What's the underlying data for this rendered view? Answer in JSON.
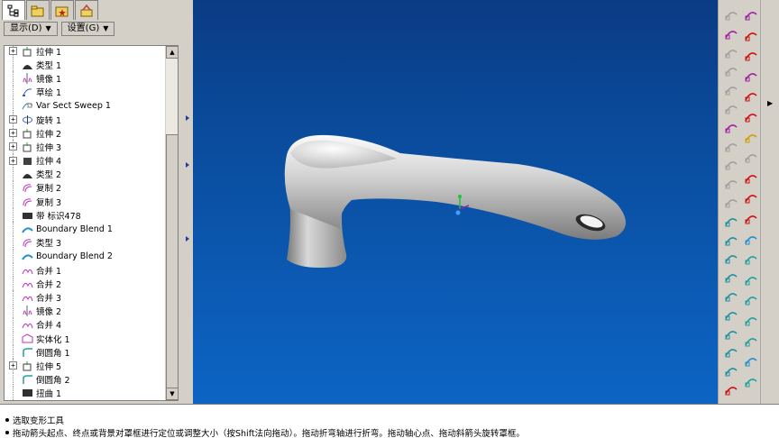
{
  "menus": {
    "show_label": "显示(D)",
    "settings_label": "设置(G)"
  },
  "tree_items": [
    {
      "label": "拉伸 1",
      "icon": "extrude-icon",
      "expandable": true
    },
    {
      "label": "类型 1",
      "icon": "style-icon",
      "expandable": false
    },
    {
      "label": "镜像 1",
      "icon": "mirror-icon",
      "expandable": false
    },
    {
      "label": "草绘 1",
      "icon": "sketch-icon",
      "expandable": false
    },
    {
      "label": "Var Sect Sweep 1",
      "icon": "sweep-icon",
      "expandable": false
    },
    {
      "label": "旋转 1",
      "icon": "revolve-icon",
      "expandable": true
    },
    {
      "label": "拉伸 2",
      "icon": "extrude-icon",
      "expandable": true
    },
    {
      "label": "拉伸 3",
      "icon": "extrude-icon",
      "expandable": true
    },
    {
      "label": "拉伸 4",
      "icon": "extrude-solid-icon",
      "expandable": true
    },
    {
      "label": "类型 2",
      "icon": "style-icon",
      "expandable": false
    },
    {
      "label": "复制 2",
      "icon": "copy-icon",
      "expandable": false
    },
    {
      "label": "复制 3",
      "icon": "copy-icon",
      "expandable": false
    },
    {
      "label": "带 标识478",
      "icon": "band-icon",
      "expandable": false
    },
    {
      "label": "Boundary Blend 1",
      "icon": "boundary-blend-icon",
      "expandable": false
    },
    {
      "label": "类型 3",
      "icon": "copy-icon",
      "expandable": false
    },
    {
      "label": "Boundary Blend 2",
      "icon": "boundary-blend-icon",
      "expandable": false
    },
    {
      "label": "合并 1",
      "icon": "merge-icon",
      "expandable": false
    },
    {
      "label": "合并 2",
      "icon": "merge-icon",
      "expandable": false
    },
    {
      "label": "合并 3",
      "icon": "merge-icon",
      "expandable": false
    },
    {
      "label": "镜像 2",
      "icon": "mirror-icon",
      "expandable": false
    },
    {
      "label": "合并 4",
      "icon": "merge-icon",
      "expandable": false
    },
    {
      "label": "实体化 1",
      "icon": "solidify-icon",
      "expandable": false
    },
    {
      "label": "倒圆角 1",
      "icon": "round-icon",
      "expandable": false
    },
    {
      "label": "拉伸 5",
      "icon": "extrude-icon",
      "expandable": true
    },
    {
      "label": "倒圆角 2",
      "icon": "round-icon",
      "expandable": false
    },
    {
      "label": "扭曲 1",
      "icon": "warp-icon",
      "expandable": false
    }
  ],
  "status": {
    "line1": "选取变形工具",
    "line2": "拖动箭头起点、终点或背景对罩框进行定位或调整大小（按Shift法向拖动）。拖动折弯轴进行折弯。拖动轴心点、拖动斜箭头旋转罩框。"
  },
  "colors": {
    "viewport_top": "#0b3b84",
    "viewport_bottom": "#0d64c4",
    "icon_purple": "#b020b0",
    "icon_red": "#d01010"
  }
}
